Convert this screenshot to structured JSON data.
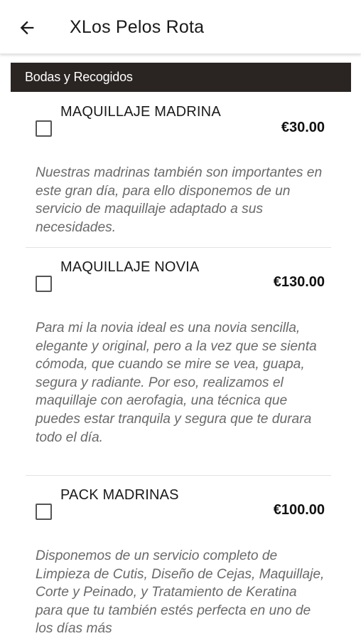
{
  "header": {
    "title": "XLos Pelos Rota",
    "back_icon": "arrow-left-icon"
  },
  "category": {
    "label": "Bodas y Recogidos"
  },
  "items": [
    {
      "name": "MAQUILLAJE MADRINA",
      "price": "€30.00",
      "checked": false,
      "description": "Nuestras madrinas también son importantes en este gran día, para ello disponemos de un servicio de maquillaje adaptado a sus necesidades."
    },
    {
      "name": "MAQUILLAJE NOVIA",
      "price": "€130.00",
      "checked": false,
      "description": "Para mi la novia ideal es una novia sencilla, elegante y original, pero a la vez que se sienta cómoda, que cuando se mire se vea, guapa, segura y radiante. Por eso, realizamos el maquillaje con aerofagia, una técnica que puedes estar tranquila y segura que te durara todo el día."
    },
    {
      "name": "PACK MADRINAS",
      "price": "€100.00",
      "checked": false,
      "description": "Disponemos de un servicio completo de Limpieza de Cutis, Diseño de Cejas, Maquillaje, Corte y Peinado, y Tratamiento de Keratina para que tu también estés perfecta en uno de los días más"
    }
  ]
}
